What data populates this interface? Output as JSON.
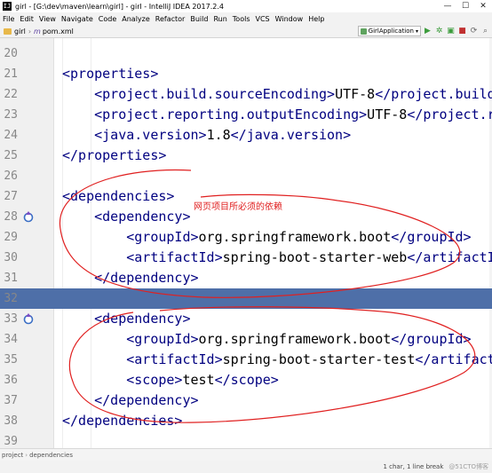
{
  "window": {
    "title": "girl - [G:\\dev\\maven\\learn\\girl] - girl - IntelliJ IDEA 2017.2.4",
    "app_icon": "intellij-icon"
  },
  "window_controls": {
    "minimize": "—",
    "maximize": "☐",
    "close": "✕"
  },
  "menu": {
    "items": [
      "File",
      "Edit",
      "View",
      "Navigate",
      "Code",
      "Analyze",
      "Refactor",
      "Build",
      "Run",
      "Tools",
      "VCS",
      "Window",
      "Help"
    ]
  },
  "navbar": {
    "project": "girl",
    "file_icon": "m",
    "file": "pom.xml",
    "run_config": "GirlApplication",
    "run_config_arrow": "▾"
  },
  "toolbar": {
    "run": "▶",
    "debug": "✲",
    "coverage": "▣",
    "stop": "■",
    "sync": "⟳",
    "search": "⌕"
  },
  "editor": {
    "lines": [
      {
        "num": "20",
        "indent": "",
        "open": "",
        "text": "",
        "close": ""
      },
      {
        "num": "21",
        "indent": "",
        "open": "<properties>",
        "text": "",
        "close": ""
      },
      {
        "num": "22",
        "indent": "    ",
        "open": "<project.build.sourceEncoding>",
        "text": "UTF-8",
        "close": "</project.build.source"
      },
      {
        "num": "23",
        "indent": "    ",
        "open": "<project.reporting.outputEncoding>",
        "text": "UTF-8",
        "close": "</project.reporti"
      },
      {
        "num": "24",
        "indent": "    ",
        "open": "<java.version>",
        "text": "1.8",
        "close": "</java.version>"
      },
      {
        "num": "25",
        "indent": "",
        "open": "</properties>",
        "text": "",
        "close": ""
      },
      {
        "num": "26",
        "indent": "",
        "open": "",
        "text": "",
        "close": ""
      },
      {
        "num": "27",
        "indent": "",
        "open": "<dependencies>",
        "text": "",
        "close": ""
      },
      {
        "num": "28",
        "indent": "    ",
        "open": "<dependency>",
        "text": "",
        "close": ""
      },
      {
        "num": "29",
        "indent": "        ",
        "open": "<groupId>",
        "text": "org.springframework.boot",
        "close": "</groupId>"
      },
      {
        "num": "30",
        "indent": "        ",
        "open": "<artifactId>",
        "text": "spring-boot-starter-web",
        "close": "</artifactId>"
      },
      {
        "num": "31",
        "indent": "    ",
        "open": "</dependency>",
        "text": "",
        "close": ""
      },
      {
        "num": "32",
        "indent": "",
        "open": "",
        "text": "",
        "close": ""
      },
      {
        "num": "33",
        "indent": "    ",
        "open": "<dependency>",
        "text": "",
        "close": ""
      },
      {
        "num": "34",
        "indent": "        ",
        "open": "<groupId>",
        "text": "org.springframework.boot",
        "close": "</groupId>"
      },
      {
        "num": "35",
        "indent": "        ",
        "open": "<artifactId>",
        "text": "spring-boot-starter-test",
        "close": "</artifactId>"
      },
      {
        "num": "36",
        "indent": "        ",
        "open": "<scope>",
        "text": "test",
        "close": "</scope>"
      },
      {
        "num": "37",
        "indent": "    ",
        "open": "</dependency>",
        "text": "",
        "close": ""
      },
      {
        "num": "38",
        "indent": "",
        "open": "</dependencies>",
        "text": "",
        "close": ""
      },
      {
        "num": "39",
        "indent": "",
        "open": "",
        "text": "",
        "close": ""
      }
    ],
    "current_line": "32",
    "gutter_markers": [
      "28",
      "33"
    ],
    "colors": {
      "tag": "#000080",
      "current_line": "#4e6fa8",
      "annotation": "#e02020"
    }
  },
  "annotation": {
    "note": "网页项目所必须的依赖"
  },
  "breadcrumbs": [
    "project",
    "dependencies"
  ],
  "status": {
    "position": "1 char, 1 line break",
    "watermark": "@51CTO博客"
  }
}
